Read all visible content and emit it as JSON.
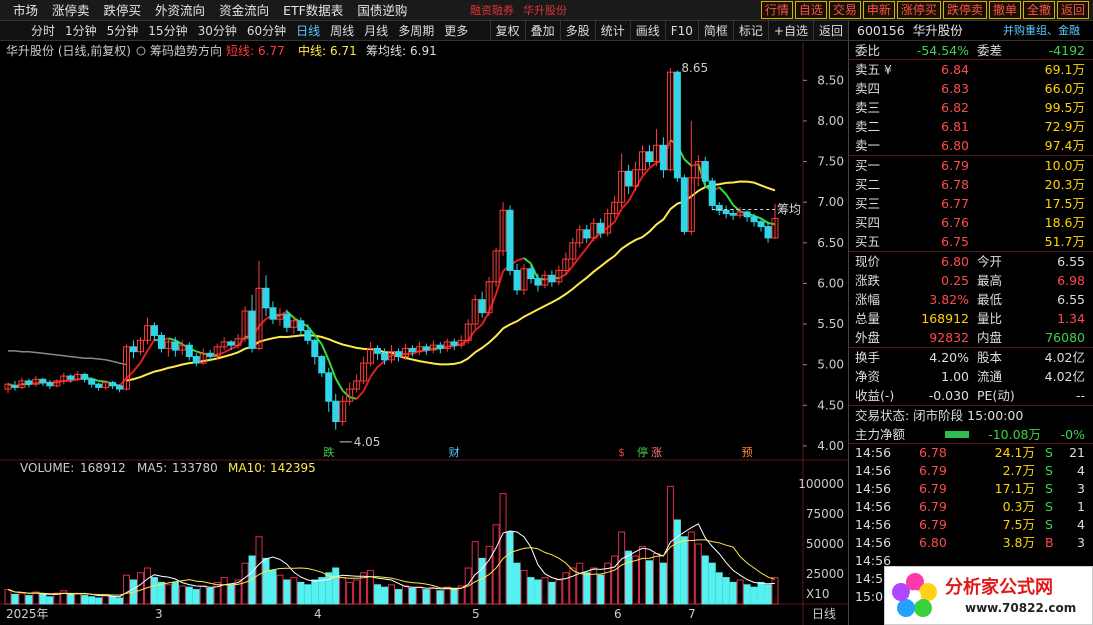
{
  "topnav": {
    "menu": [
      "市场",
      "涨停卖",
      "跌停买",
      "外资流向",
      "资金流向",
      "ETF数据表",
      "国债逆购"
    ],
    "tag_left": "融资融券",
    "tag_right": "华升股份",
    "quick": [
      "行情",
      "自选",
      "交易",
      "申新",
      "涨停买",
      "跌停卖",
      "撤单",
      "全撤",
      "返回"
    ]
  },
  "toolbar": {
    "periods": [
      "分时",
      "1分钟",
      "5分钟",
      "15分钟",
      "30分钟",
      "60分钟",
      "日线",
      "周线",
      "月线",
      "多周期",
      "更多"
    ],
    "active_period": "日线",
    "tools": [
      "复权",
      "叠加",
      "多股",
      "统计",
      "画线",
      "F10",
      "简框",
      "标记",
      "+自选",
      "返回"
    ]
  },
  "chart_header": {
    "name": "华升股份 (日线,前复权)",
    "indicator": "筹码趋势方向",
    "short_label": "短线:",
    "short_val": "6.77",
    "mid_label": "中线:",
    "mid_val": "6.71",
    "avg_label": "筹均线:",
    "avg_val": "6.91"
  },
  "colors": {
    "up": "#ff3b3b",
    "down": "#2fd6e8",
    "short_line_up": "#e02020",
    "short_line_down": "#33dd33",
    "mid_line": "#ffe94a",
    "gray_line": "#888888",
    "volume_up": "#d9304a",
    "volume_down": "#55f0f0"
  },
  "chart_data": {
    "type": "candlestick",
    "price_axis": [
      "8.50",
      "8.00",
      "7.50",
      "7.00",
      "6.50",
      "6.00",
      "5.50",
      "5.00",
      "4.50",
      "4.00"
    ],
    "price_range": [
      3.95,
      8.75
    ],
    "high_label": "8.65",
    "low_label": "4.05",
    "chip_label": "筹均",
    "markers": [
      "跌",
      "财",
      "$",
      "停",
      "涨",
      "预"
    ],
    "x_labels": [
      "2025年",
      "3",
      "4",
      "5",
      "6",
      "7"
    ],
    "volume_axis": [
      "100000",
      "75000",
      "50000",
      "25000"
    ],
    "volume_range": [
      0,
      110000
    ],
    "volume_unit": "X10",
    "period_tag": "日线",
    "candles": [
      [
        4.7,
        4.76,
        4.65,
        4.78
      ],
      [
        4.74,
        4.72,
        4.68,
        4.8
      ],
      [
        4.72,
        4.8,
        4.7,
        4.84
      ],
      [
        4.8,
        4.76,
        4.72,
        4.83
      ],
      [
        4.76,
        4.82,
        4.73,
        4.86
      ],
      [
        4.82,
        4.78,
        4.74,
        4.84
      ],
      [
        4.78,
        4.74,
        4.7,
        4.81
      ],
      [
        4.74,
        4.8,
        4.72,
        4.82
      ],
      [
        4.8,
        4.86,
        4.76,
        4.9
      ],
      [
        4.86,
        4.82,
        4.78,
        4.88
      ],
      [
        4.82,
        4.88,
        4.8,
        4.92
      ],
      [
        4.88,
        4.82,
        4.78,
        4.9
      ],
      [
        4.82,
        4.76,
        4.72,
        4.84
      ],
      [
        4.76,
        4.72,
        4.68,
        4.78
      ],
      [
        4.72,
        4.78,
        4.69,
        4.8
      ],
      [
        4.78,
        4.74,
        4.7,
        4.8
      ],
      [
        4.74,
        4.7,
        4.66,
        4.76
      ],
      [
        4.7,
        5.22,
        4.68,
        5.25
      ],
      [
        5.22,
        5.16,
        5.08,
        5.3
      ],
      [
        5.16,
        5.3,
        5.12,
        5.34
      ],
      [
        5.3,
        5.48,
        5.25,
        5.58
      ],
      [
        5.48,
        5.36,
        5.3,
        5.52
      ],
      [
        5.36,
        5.2,
        5.15,
        5.4
      ],
      [
        5.2,
        5.28,
        5.1,
        5.32
      ],
      [
        5.28,
        5.18,
        5.1,
        5.34
      ],
      [
        5.18,
        5.24,
        5.12,
        5.3
      ],
      [
        5.24,
        5.1,
        5.05,
        5.28
      ],
      [
        5.1,
        5.02,
        4.98,
        5.14
      ],
      [
        5.02,
        5.14,
        5.0,
        5.2
      ],
      [
        5.14,
        5.1,
        5.04,
        5.18
      ],
      [
        5.1,
        5.22,
        5.06,
        5.26
      ],
      [
        5.22,
        5.28,
        5.18,
        5.34
      ],
      [
        5.28,
        5.24,
        5.18,
        5.3
      ],
      [
        5.24,
        5.32,
        5.2,
        5.38
      ],
      [
        5.32,
        5.66,
        5.28,
        5.72
      ],
      [
        5.66,
        5.2,
        5.15,
        5.86
      ],
      [
        5.2,
        5.94,
        5.18,
        6.28
      ],
      [
        5.94,
        5.7,
        5.6,
        6.1
      ],
      [
        5.7,
        5.56,
        5.5,
        5.78
      ],
      [
        5.56,
        5.62,
        5.48,
        5.7
      ],
      [
        5.62,
        5.46,
        5.4,
        5.68
      ],
      [
        5.46,
        5.54,
        5.38,
        5.6
      ],
      [
        5.54,
        5.42,
        5.36,
        5.58
      ],
      [
        5.42,
        5.3,
        5.25,
        5.5
      ],
      [
        5.3,
        5.1,
        5.0,
        5.32
      ],
      [
        5.1,
        4.9,
        4.85,
        5.12
      ],
      [
        4.9,
        4.55,
        4.42,
        4.96
      ],
      [
        4.55,
        4.3,
        4.2,
        4.64
      ],
      [
        4.3,
        4.55,
        4.25,
        4.62
      ],
      [
        4.55,
        4.7,
        4.5,
        4.78
      ],
      [
        4.7,
        4.8,
        4.66,
        4.88
      ],
      [
        4.8,
        5.02,
        4.76,
        5.1
      ],
      [
        5.02,
        5.2,
        4.98,
        5.28
      ],
      [
        5.2,
        5.14,
        5.06,
        5.24
      ],
      [
        5.14,
        5.06,
        5.0,
        5.2
      ],
      [
        5.06,
        5.16,
        5.02,
        5.24
      ],
      [
        5.16,
        5.1,
        5.04,
        5.2
      ],
      [
        5.1,
        5.2,
        5.06,
        5.26
      ],
      [
        5.2,
        5.16,
        5.1,
        5.24
      ],
      [
        5.16,
        5.22,
        5.12,
        5.28
      ],
      [
        5.22,
        5.18,
        5.12,
        5.26
      ],
      [
        5.18,
        5.24,
        5.14,
        5.3
      ],
      [
        5.24,
        5.2,
        5.14,
        5.28
      ],
      [
        5.2,
        5.28,
        5.16,
        5.32
      ],
      [
        5.28,
        5.24,
        5.18,
        5.32
      ],
      [
        5.24,
        5.3,
        5.2,
        5.36
      ],
      [
        5.3,
        5.5,
        5.26,
        5.56
      ],
      [
        5.5,
        5.8,
        5.44,
        5.86
      ],
      [
        5.8,
        5.64,
        5.58,
        5.9
      ],
      [
        5.64,
        6.02,
        5.6,
        6.08
      ],
      [
        6.02,
        6.4,
        5.96,
        6.44
      ],
      [
        6.4,
        6.9,
        6.34,
        7.0
      ],
      [
        6.9,
        6.16,
        6.1,
        6.96
      ],
      [
        6.16,
        5.92,
        5.86,
        6.24
      ],
      [
        5.92,
        6.18,
        5.86,
        6.24
      ],
      [
        6.18,
        6.06,
        6.0,
        6.24
      ],
      [
        6.06,
        5.98,
        5.9,
        6.12
      ],
      [
        5.98,
        6.1,
        5.94,
        6.16
      ],
      [
        6.1,
        6.02,
        5.96,
        6.16
      ],
      [
        6.02,
        6.16,
        5.98,
        6.22
      ],
      [
        6.16,
        6.3,
        6.1,
        6.38
      ],
      [
        6.3,
        6.5,
        6.22,
        6.56
      ],
      [
        6.5,
        6.66,
        6.44,
        6.72
      ],
      [
        6.66,
        6.56,
        6.5,
        6.72
      ],
      [
        6.56,
        6.74,
        6.52,
        6.8
      ],
      [
        6.74,
        6.62,
        6.56,
        6.8
      ],
      [
        6.62,
        6.86,
        6.58,
        6.92
      ],
      [
        6.86,
        7.0,
        6.8,
        7.08
      ],
      [
        7.0,
        7.38,
        6.94,
        7.6
      ],
      [
        7.38,
        7.2,
        7.1,
        7.46
      ],
      [
        7.2,
        7.4,
        7.14,
        7.5
      ],
      [
        7.4,
        7.62,
        7.34,
        7.7
      ],
      [
        7.62,
        7.5,
        7.44,
        7.7
      ],
      [
        7.5,
        7.7,
        7.44,
        7.9
      ],
      [
        7.7,
        7.4,
        7.3,
        7.8
      ],
      [
        7.4,
        8.6,
        7.38,
        8.65
      ],
      [
        8.6,
        7.3,
        7.25,
        8.62
      ],
      [
        7.3,
        6.64,
        6.6,
        7.34
      ],
      [
        6.64,
        7.3,
        6.6,
        8.0
      ],
      [
        7.3,
        7.5,
        7.2,
        7.58
      ],
      [
        7.5,
        7.26,
        7.2,
        7.56
      ],
      [
        7.26,
        6.96,
        6.9,
        7.3
      ],
      [
        6.96,
        6.9,
        6.84,
        7.0
      ],
      [
        6.9,
        6.86,
        6.8,
        6.96
      ],
      [
        6.86,
        6.84,
        6.78,
        6.92
      ],
      [
        6.84,
        6.88,
        6.8,
        6.94
      ],
      [
        6.88,
        6.82,
        6.76,
        6.9
      ],
      [
        6.82,
        6.76,
        6.7,
        6.86
      ],
      [
        6.76,
        6.7,
        6.64,
        6.8
      ],
      [
        6.7,
        6.56,
        6.5,
        6.76
      ],
      [
        6.56,
        6.8,
        6.55,
        6.98
      ]
    ],
    "volume": [
      [
        12000,
        0
      ],
      [
        8000,
        1
      ],
      [
        9000,
        0
      ],
      [
        7000,
        1
      ],
      [
        10000,
        0
      ],
      [
        8000,
        1
      ],
      [
        6000,
        1
      ],
      [
        9000,
        0
      ],
      [
        11000,
        0
      ],
      [
        8000,
        1
      ],
      [
        9000,
        0
      ],
      [
        7000,
        1
      ],
      [
        6000,
        1
      ],
      [
        5000,
        1
      ],
      [
        8000,
        0
      ],
      [
        6000,
        1
      ],
      [
        5000,
        1
      ],
      [
        24000,
        0
      ],
      [
        20000,
        1
      ],
      [
        26000,
        0
      ],
      [
        30000,
        0
      ],
      [
        22000,
        1
      ],
      [
        18000,
        1
      ],
      [
        16000,
        0
      ],
      [
        18000,
        1
      ],
      [
        15000,
        0
      ],
      [
        14000,
        1
      ],
      [
        12000,
        1
      ],
      [
        15000,
        0
      ],
      [
        13000,
        1
      ],
      [
        18000,
        0
      ],
      [
        22000,
        0
      ],
      [
        16000,
        1
      ],
      [
        20000,
        0
      ],
      [
        34000,
        0
      ],
      [
        40000,
        1
      ],
      [
        56000,
        0
      ],
      [
        38000,
        1
      ],
      [
        28000,
        1
      ],
      [
        24000,
        0
      ],
      [
        20000,
        1
      ],
      [
        22000,
        0
      ],
      [
        18000,
        1
      ],
      [
        16000,
        1
      ],
      [
        20000,
        1
      ],
      [
        22000,
        1
      ],
      [
        26000,
        1
      ],
      [
        30000,
        1
      ],
      [
        22000,
        0
      ],
      [
        18000,
        0
      ],
      [
        20000,
        0
      ],
      [
        26000,
        0
      ],
      [
        28000,
        0
      ],
      [
        16000,
        1
      ],
      [
        14000,
        1
      ],
      [
        16000,
        0
      ],
      [
        12000,
        1
      ],
      [
        15000,
        0
      ],
      [
        13000,
        1
      ],
      [
        14000,
        0
      ],
      [
        12000,
        1
      ],
      [
        13000,
        0
      ],
      [
        11000,
        1
      ],
      [
        14000,
        0
      ],
      [
        12000,
        1
      ],
      [
        15000,
        0
      ],
      [
        30000,
        0
      ],
      [
        52000,
        0
      ],
      [
        38000,
        1
      ],
      [
        48000,
        0
      ],
      [
        66000,
        0
      ],
      [
        92000,
        0
      ],
      [
        60000,
        1
      ],
      [
        34000,
        1
      ],
      [
        28000,
        0
      ],
      [
        22000,
        1
      ],
      [
        20000,
        1
      ],
      [
        22000,
        0
      ],
      [
        18000,
        1
      ],
      [
        20000,
        0
      ],
      [
        26000,
        0
      ],
      [
        30000,
        0
      ],
      [
        34000,
        0
      ],
      [
        26000,
        1
      ],
      [
        30000,
        0
      ],
      [
        24000,
        1
      ],
      [
        34000,
        0
      ],
      [
        40000,
        0
      ],
      [
        60000,
        0
      ],
      [
        44000,
        1
      ],
      [
        40000,
        0
      ],
      [
        48000,
        0
      ],
      [
        36000,
        1
      ],
      [
        42000,
        0
      ],
      [
        34000,
        1
      ],
      [
        98000,
        0
      ],
      [
        70000,
        1
      ],
      [
        56000,
        1
      ],
      [
        60000,
        0
      ],
      [
        50000,
        0
      ],
      [
        40000,
        1
      ],
      [
        34000,
        1
      ],
      [
        26000,
        1
      ],
      [
        22000,
        1
      ],
      [
        18000,
        1
      ],
      [
        20000,
        0
      ],
      [
        16000,
        1
      ],
      [
        14000,
        1
      ],
      [
        18000,
        1
      ],
      [
        16000,
        1
      ],
      [
        22000,
        0
      ]
    ]
  },
  "panel": {
    "code": "600156",
    "name": "华升股份",
    "tags": "并购重组、金融",
    "weibi_label": "委比",
    "weibi": "-54.54%",
    "weicha_label": "委差",
    "weicha": "-4192",
    "asks": [
      {
        "label": "卖五 ¥",
        "price": "6.84",
        "vol": "69.1万"
      },
      {
        "label": "卖四",
        "price": "6.83",
        "vol": "66.0万"
      },
      {
        "label": "卖三",
        "price": "6.82",
        "vol": "99.5万"
      },
      {
        "label": "卖二",
        "price": "6.81",
        "vol": "72.9万"
      },
      {
        "label": "卖一",
        "price": "6.80",
        "vol": "97.4万"
      }
    ],
    "bids": [
      {
        "label": "买一",
        "price": "6.79",
        "vol": "10.0万"
      },
      {
        "label": "买二",
        "price": "6.78",
        "vol": "20.3万"
      },
      {
        "label": "买三",
        "price": "6.77",
        "vol": "17.5万"
      },
      {
        "label": "买四",
        "price": "6.76",
        "vol": "18.6万"
      },
      {
        "label": "买五",
        "price": "6.75",
        "vol": "51.7万"
      }
    ],
    "stats": [
      {
        "l1": "现价",
        "v1": "6.80",
        "c1": "red",
        "l2": "今开",
        "v2": "6.55",
        "c2": "white"
      },
      {
        "l1": "涨跌",
        "v1": "0.25",
        "c1": "red",
        "l2": "最高",
        "v2": "6.98",
        "c2": "red"
      },
      {
        "l1": "涨幅",
        "v1": "3.82%",
        "c1": "red",
        "l2": "最低",
        "v2": "6.55",
        "c2": "white"
      },
      {
        "l1": "总量",
        "v1": "168912",
        "c1": "yellow",
        "l2": "量比",
        "v2": "1.34",
        "c2": "red"
      },
      {
        "l1": "外盘",
        "v1": "92832",
        "c1": "red",
        "l2": "内盘",
        "v2": "76080",
        "c2": "green"
      }
    ],
    "stats2": [
      {
        "l1": "换手",
        "v1": "4.20%",
        "c1": "white",
        "l2": "股本",
        "v2": "4.02亿",
        "c2": "white"
      },
      {
        "l1": "净资",
        "v1": "1.00",
        "c1": "white",
        "l2": "流通",
        "v2": "4.02亿",
        "c2": "white"
      },
      {
        "l1": "收益(-)",
        "v1": "-0.030",
        "c1": "white",
        "l2": "PE(动)",
        "v2": "--",
        "c2": "white"
      }
    ],
    "trade_status": "交易状态: 闭市阶段 15:00:00",
    "main_flow_label": "主力净额",
    "main_flow_val": "-10.08万",
    "main_flow_pct": "-0%",
    "ticks": [
      {
        "t": "14:56",
        "p": "6.78",
        "v": "24.1万",
        "s": "S",
        "n": "21"
      },
      {
        "t": "14:56",
        "p": "6.79",
        "v": "2.7万",
        "s": "S",
        "n": "4"
      },
      {
        "t": "14:56",
        "p": "6.79",
        "v": "17.1万",
        "s": "S",
        "n": "3"
      },
      {
        "t": "14:56",
        "p": "6.79",
        "v": "0.3万",
        "s": "S",
        "n": "1"
      },
      {
        "t": "14:56",
        "p": "6.79",
        "v": "7.5万",
        "s": "S",
        "n": "4"
      },
      {
        "t": "14:56",
        "p": "6.80",
        "v": "3.8万",
        "s": "B",
        "n": "3"
      },
      {
        "t": "14:56",
        "p": "",
        "v": "",
        "s": "",
        "n": ""
      },
      {
        "t": "14:57",
        "p": "",
        "v": "",
        "s": "",
        "n": ""
      },
      {
        "t": "15:00",
        "p": "",
        "v": "",
        "s": "",
        "n": ""
      }
    ]
  },
  "volume_header": {
    "label": "VOLUME:",
    "val": "168912",
    "ma5_label": "MA5:",
    "ma5": "133780",
    "ma10_label": "MA10:",
    "ma10": "142395"
  },
  "logo": {
    "title": "分析家公式网",
    "url": "www.70822.com"
  }
}
